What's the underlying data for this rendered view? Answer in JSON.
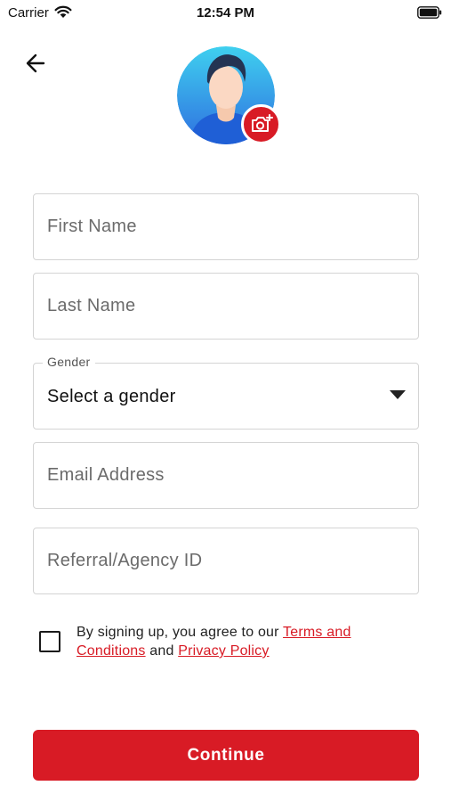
{
  "status_bar": {
    "carrier": "Carrier",
    "time": "12:54 PM",
    "icons": [
      "wifi-icon",
      "battery-icon"
    ]
  },
  "header": {
    "back_icon": "arrow-left-icon"
  },
  "avatar": {
    "icon": "user-avatar-icon",
    "camera_icon": "camera-add-icon"
  },
  "form": {
    "first_name": {
      "placeholder": "First Name",
      "value": ""
    },
    "last_name": {
      "placeholder": "Last Name",
      "value": ""
    },
    "gender": {
      "label": "Gender",
      "value": "Select a gender",
      "icon": "caret-down-icon"
    },
    "email": {
      "placeholder": "Email Address",
      "value": ""
    },
    "referral": {
      "placeholder": "Referral/Agency ID",
      "value": ""
    }
  },
  "terms": {
    "checked": false,
    "prefix": "By signing up, you agree to our ",
    "terms_link": "Terms and Conditions",
    "conjunction": " and ",
    "privacy_link": "Privacy Policy"
  },
  "continue_label": "Continue",
  "colors": {
    "accent": "#d81b25",
    "border": "#d4d4d4",
    "placeholder": "#6b6b6b",
    "avatar_bg_top": "#3fd0ef",
    "avatar_bg_bottom": "#2f6fe0"
  }
}
